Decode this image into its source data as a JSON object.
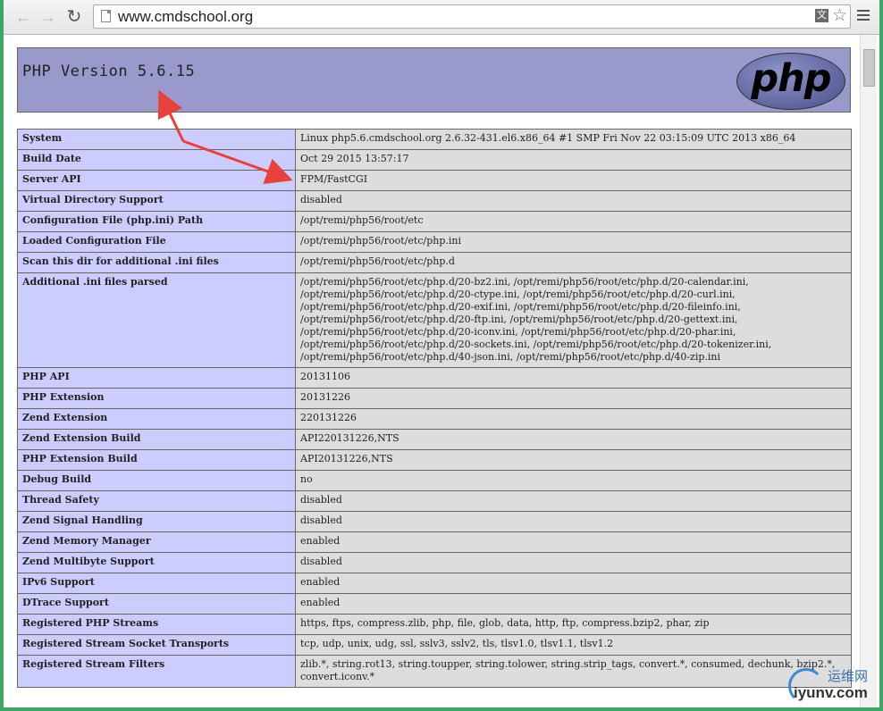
{
  "browser": {
    "url": "www.cmdschool.org",
    "translate_glyph": "文",
    "back_icon": "arrow-left-icon",
    "forward_icon": "arrow-right-icon",
    "reload_icon": "reload-icon",
    "star_icon": "star-icon",
    "menu_icon": "hamburger-menu-icon"
  },
  "php": {
    "title": "PHP Version 5.6.15",
    "logo_text": "php"
  },
  "rows": [
    {
      "label": "System",
      "value": "Linux php5.6.cmdschool.org 2.6.32-431.el6.x86_64 #1 SMP Fri Nov 22 03:15:09 UTC 2013 x86_64"
    },
    {
      "label": "Build Date",
      "value": "Oct 29 2015 13:57:17"
    },
    {
      "label": "Server API",
      "value": "FPM/FastCGI"
    },
    {
      "label": "Virtual Directory Support",
      "value": "disabled"
    },
    {
      "label": "Configuration File (php.ini) Path",
      "value": "/opt/remi/php56/root/etc"
    },
    {
      "label": "Loaded Configuration File",
      "value": "/opt/remi/php56/root/etc/php.ini"
    },
    {
      "label": "Scan this dir for additional .ini files",
      "value": "/opt/remi/php56/root/etc/php.d"
    },
    {
      "label": "Additional .ini files parsed",
      "value": "/opt/remi/php56/root/etc/php.d/20-bz2.ini, /opt/remi/php56/root/etc/php.d/20-calendar.ini, /opt/remi/php56/root/etc/php.d/20-ctype.ini, /opt/remi/php56/root/etc/php.d/20-curl.ini, /opt/remi/php56/root/etc/php.d/20-exif.ini, /opt/remi/php56/root/etc/php.d/20-fileinfo.ini, /opt/remi/php56/root/etc/php.d/20-ftp.ini, /opt/remi/php56/root/etc/php.d/20-gettext.ini, /opt/remi/php56/root/etc/php.d/20-iconv.ini, /opt/remi/php56/root/etc/php.d/20-phar.ini, /opt/remi/php56/root/etc/php.d/20-sockets.ini, /opt/remi/php56/root/etc/php.d/20-tokenizer.ini, /opt/remi/php56/root/etc/php.d/40-json.ini, /opt/remi/php56/root/etc/php.d/40-zip.ini"
    },
    {
      "label": "PHP API",
      "value": "20131106"
    },
    {
      "label": "PHP Extension",
      "value": "20131226"
    },
    {
      "label": "Zend Extension",
      "value": "220131226"
    },
    {
      "label": "Zend Extension Build",
      "value": "API220131226,NTS"
    },
    {
      "label": "PHP Extension Build",
      "value": "API20131226,NTS"
    },
    {
      "label": "Debug Build",
      "value": "no"
    },
    {
      "label": "Thread Safety",
      "value": "disabled"
    },
    {
      "label": "Zend Signal Handling",
      "value": "disabled"
    },
    {
      "label": "Zend Memory Manager",
      "value": "enabled"
    },
    {
      "label": "Zend Multibyte Support",
      "value": "disabled"
    },
    {
      "label": "IPv6 Support",
      "value": "enabled"
    },
    {
      "label": "DTrace Support",
      "value": "enabled"
    },
    {
      "label": "Registered PHP Streams",
      "value": "https, ftps, compress.zlib, php, file, glob, data, http, ftp, compress.bzip2, phar, zip"
    },
    {
      "label": "Registered Stream Socket Transports",
      "value": "tcp, udp, unix, udg, ssl, sslv3, sslv2, tls, tlsv1.0, tlsv1.1, tlsv1.2"
    },
    {
      "label": "Registered Stream Filters",
      "value": "zlib.*, string.rot13, string.toupper, string.tolower, string.strip_tags, convert.*, consumed, dechunk, bzip2.*, convert.iconv.*"
    }
  ],
  "watermark": {
    "top_text": "运维网",
    "bottom_text": "iyunv.com"
  },
  "colors": {
    "header_bg": "#9999cc",
    "label_bg": "#ccccff",
    "value_bg": "#dddddd",
    "annotation_arrow": "#e8403a"
  }
}
